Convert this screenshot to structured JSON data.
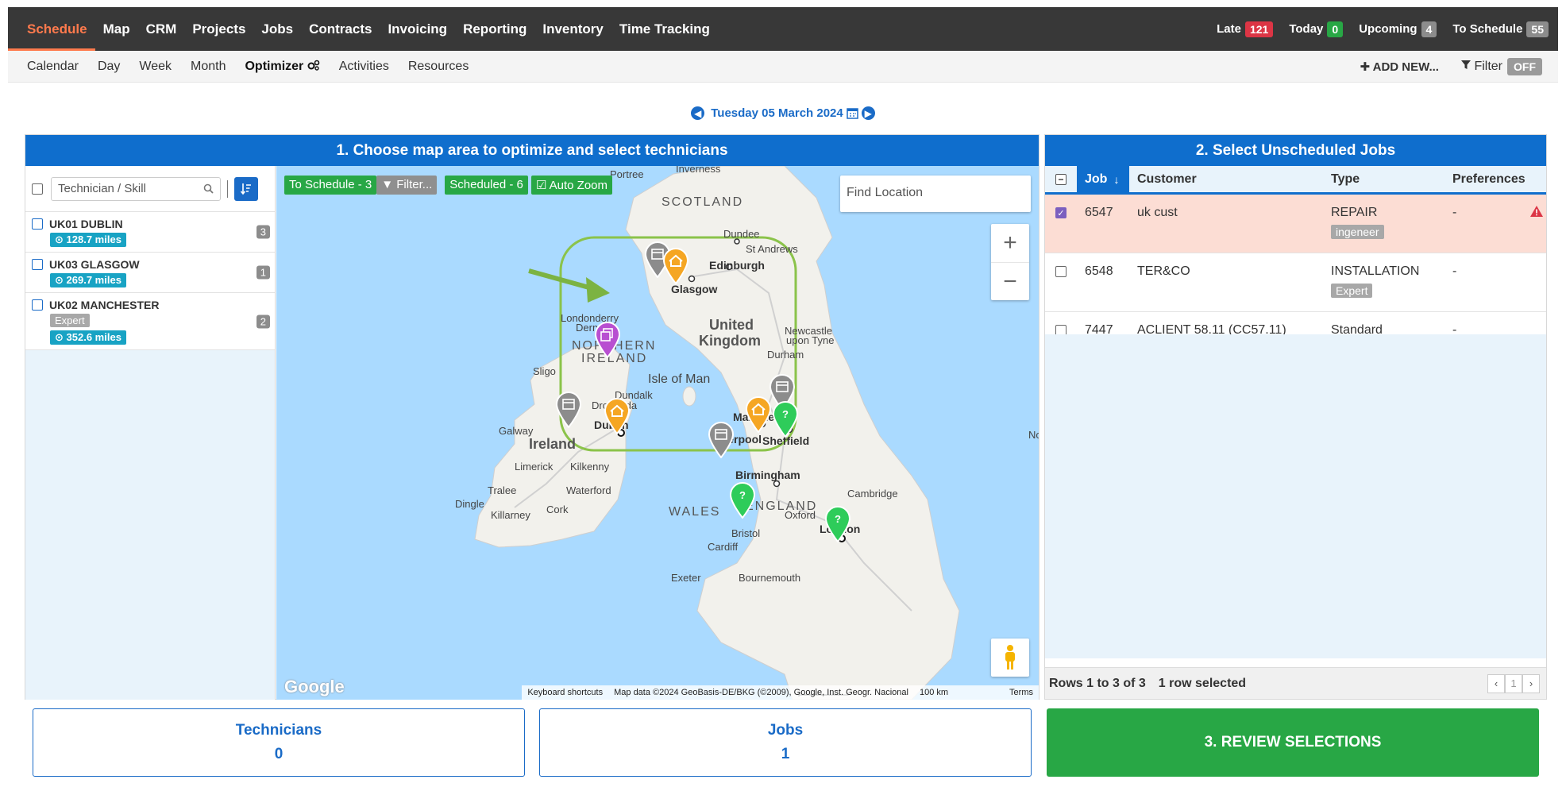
{
  "nav": {
    "items": [
      {
        "label": "Schedule",
        "active": true
      },
      {
        "label": "Map"
      },
      {
        "label": "CRM"
      },
      {
        "label": "Projects"
      },
      {
        "label": "Jobs"
      },
      {
        "label": "Contracts"
      },
      {
        "label": "Invoicing"
      },
      {
        "label": "Reporting"
      },
      {
        "label": "Inventory"
      },
      {
        "label": "Time Tracking"
      }
    ],
    "counts": [
      {
        "label": "Late",
        "value": "121",
        "color": "#dc3545"
      },
      {
        "label": "Today",
        "value": "0",
        "color": "#28a745"
      },
      {
        "label": "Upcoming",
        "value": "4",
        "color": "#8c8c8c"
      },
      {
        "label": "To Schedule",
        "value": "55",
        "color": "#8c8c8c"
      }
    ]
  },
  "subnav": {
    "items": [
      {
        "label": "Calendar"
      },
      {
        "label": "Day"
      },
      {
        "label": "Week"
      },
      {
        "label": "Month"
      },
      {
        "label": "Optimizer",
        "active": true
      },
      {
        "label": "Activities"
      },
      {
        "label": "Resources"
      }
    ],
    "add_new": "ADD NEW...",
    "filter_label": "Filter",
    "filter_state": "OFF"
  },
  "date": "Tuesday 05 March 2024",
  "left_panel": {
    "title": "1. Choose map area to optimize and select technicians",
    "search_placeholder": "Technician / Skill",
    "technicians": [
      {
        "name": "UK01 DUBLIN",
        "miles": "128.7 miles",
        "skill": "",
        "count": "3"
      },
      {
        "name": "UK03 GLASGOW",
        "miles": "269.7 miles",
        "skill": "",
        "count": "1"
      },
      {
        "name": "UK02 MANCHESTER",
        "miles": "352.6 miles",
        "skill": "Expert",
        "count": "2"
      }
    ]
  },
  "map": {
    "to_schedule": "To Schedule - 3",
    "filter": "Filter...",
    "scheduled": "Scheduled - 6",
    "auto_zoom": "Auto Zoom",
    "find_location_placeholder": "Find Location",
    "google": "Google",
    "attribution": {
      "shortcuts": "Keyboard shortcuts",
      "data": "Map data ©2024 GeoBasis-DE/BKG (©2009), Google, Inst. Geogr. Nacional",
      "scale": "100 km",
      "terms": "Terms"
    },
    "labels": {
      "portree": "Portree",
      "inverness": "Inverness",
      "scotland": "SCOTLAND",
      "dundee": "Dundee",
      "st_andrews": "St Andrews",
      "edinburgh": "Edinburgh",
      "glasgow": "Glasgow",
      "londonderry": "Londonderry",
      "derry": "Derry",
      "northern": "NORTHERN",
      "ireland_n": "IRELAND",
      "united": "United",
      "kingdom": "Kingdom",
      "newcastle": "Newcastle",
      "upon_tyne": "upon Tyne",
      "durham": "Durham",
      "sligo": "Sligo",
      "isle_of_man": "Isle of Man",
      "dundalk": "Dundalk",
      "drogheda": "Drogheda",
      "galway": "Galway",
      "dublin": "Dublin",
      "ireland": "Ireland",
      "manchester": "Manchester",
      "liverpool": "Liverpool",
      "sheffield": "Sheffield",
      "limerick": "Limerick",
      "kilkenny": "Kilkenny",
      "birmingham": "Birmingham",
      "tralee": "Tralee",
      "waterford": "Waterford",
      "cambridge": "Cambridge",
      "wales": "WALES",
      "england": "ENGLAND",
      "dingle": "Dingle",
      "cork": "Cork",
      "killarney": "Killarney",
      "oxford": "Oxford",
      "bristol": "Bristol",
      "london": "London",
      "cardiff": "Cardiff",
      "exeter": "Exeter",
      "bournemouth": "Bournemouth",
      "no": "No"
    }
  },
  "right_panel": {
    "title": "2. Select Unscheduled Jobs",
    "columns": {
      "job": "Job",
      "customer": "Customer",
      "type": "Type",
      "preferences": "Preferences"
    },
    "jobs": [
      {
        "job": "6547",
        "customer": "uk cust",
        "type": "REPAIR",
        "badge": "ingeneer",
        "pref": "-",
        "selected": true
      },
      {
        "job": "6548",
        "customer": "TER&CO",
        "type": "INSTALLATION",
        "badge": "Expert",
        "pref": "-",
        "selected": false
      },
      {
        "job": "7447",
        "customer": "ACLIENT 58.11 (CC57.11)",
        "type": "Standard",
        "badge": "",
        "pref": "-",
        "selected": false
      }
    ],
    "footer_rows": "Rows 1 to 3 of 3",
    "footer_selected": "1 row selected",
    "page": "1"
  },
  "summary": {
    "technicians_label": "Technicians",
    "technicians_value": "0",
    "jobs_label": "Jobs",
    "jobs_value": "1",
    "review_label": "3. REVIEW SELECTIONS"
  }
}
